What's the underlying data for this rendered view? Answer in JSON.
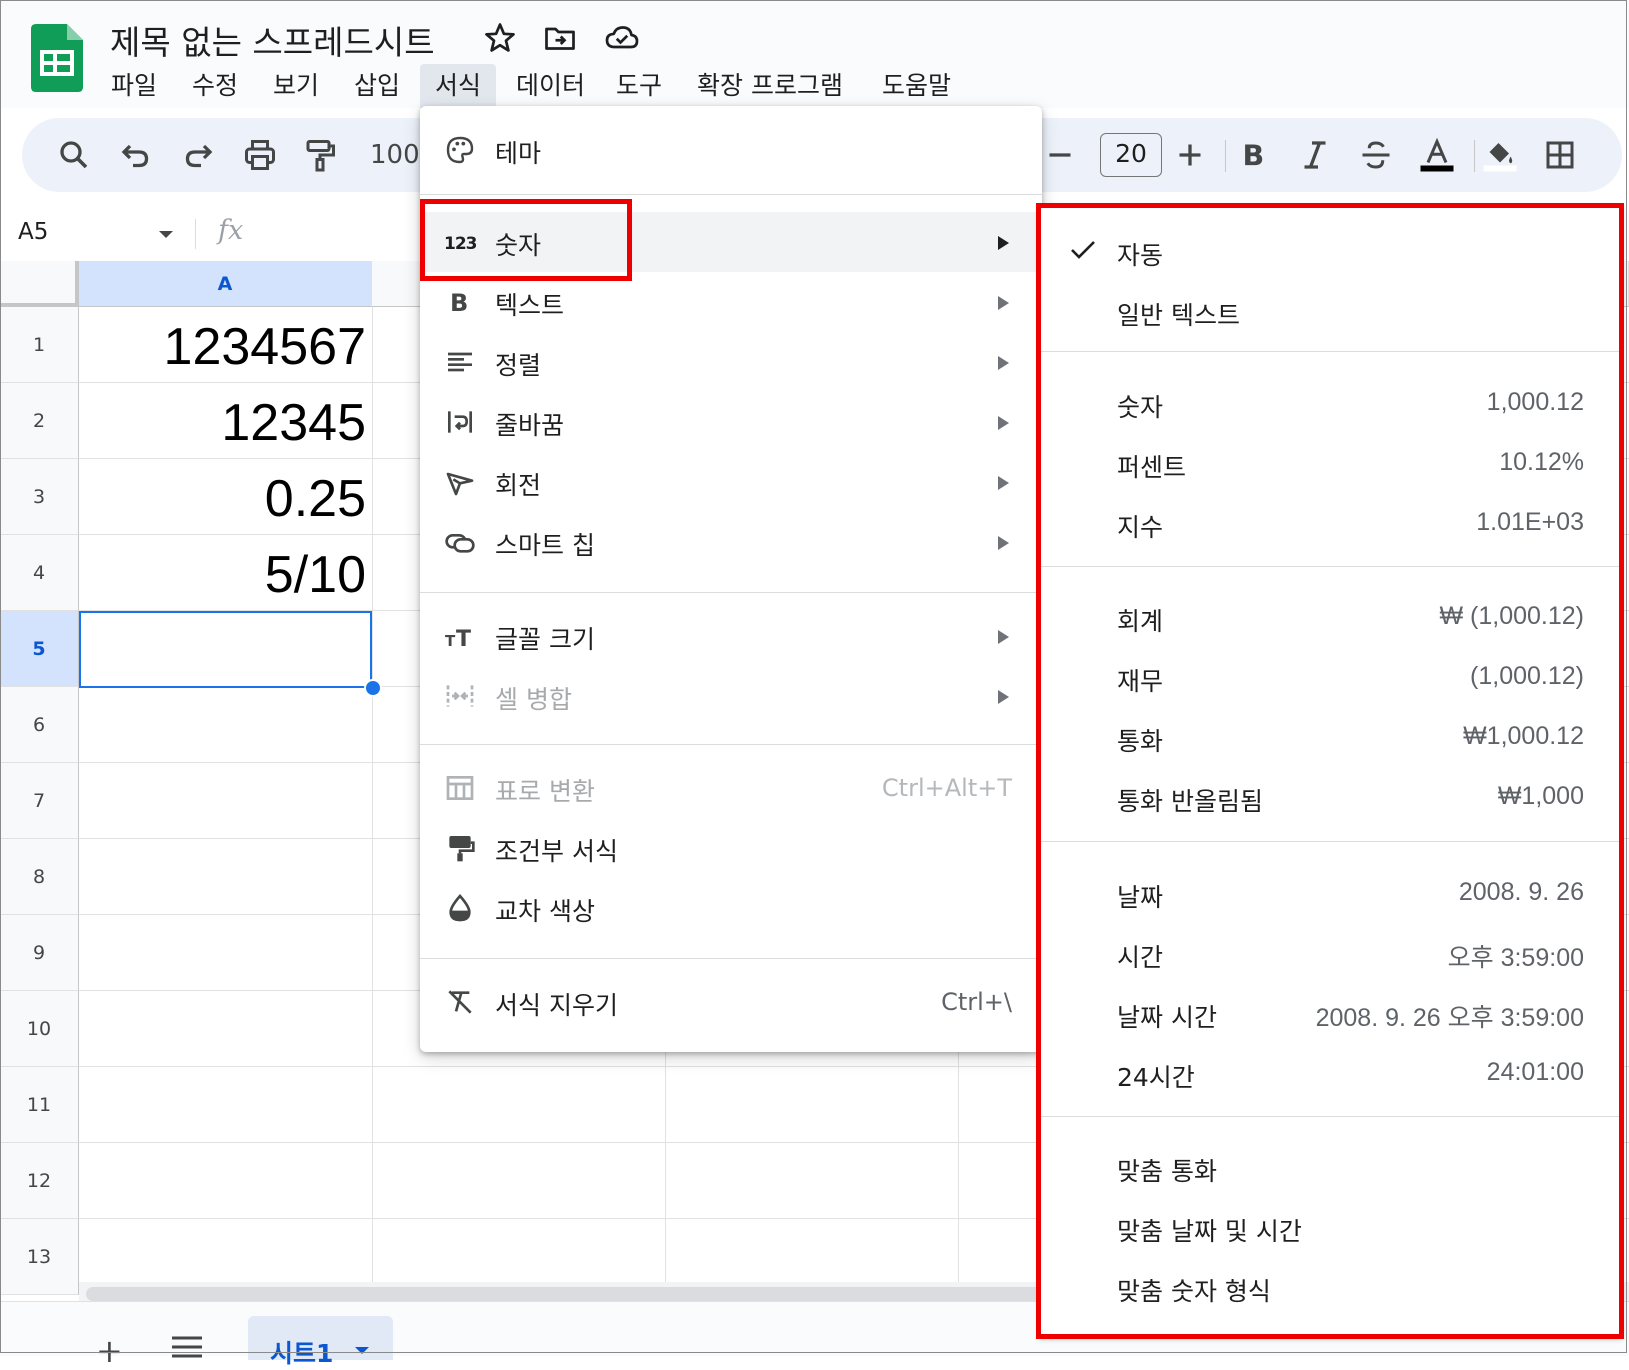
{
  "app": {
    "title": "제목 없는 스프레드시트",
    "menus": [
      "파일",
      "수정",
      "보기",
      "삽입",
      "서식",
      "데이터",
      "도구",
      "확장 프로그램",
      "도움말"
    ],
    "active_menu": "서식"
  },
  "toolbar": {
    "zoom": "100",
    "font_size": "20",
    "icons": [
      "search-icon",
      "undo-icon",
      "redo-icon",
      "print-icon",
      "paint-format-icon",
      "decrease-font-icon",
      "increase-font-icon",
      "bold-icon",
      "italic-icon",
      "strikethrough-icon",
      "text-color-icon",
      "fill-color-icon",
      "borders-icon"
    ]
  },
  "formula_bar": {
    "cell_ref": "A5",
    "fx": "fx"
  },
  "grid": {
    "column_headers": [
      "A"
    ],
    "row_numbers": [
      "1",
      "2",
      "3",
      "4",
      "5",
      "6",
      "7",
      "8",
      "9",
      "10",
      "11",
      "12",
      "13"
    ],
    "cells": [
      "1234567",
      "12345",
      "0.25",
      "5/10"
    ],
    "selected_cell": "A5"
  },
  "sheets": {
    "tabs": [
      "시트1"
    ]
  },
  "format_menu": {
    "items": [
      {
        "label": "테마",
        "icon": "palette-icon"
      },
      {
        "label": "숫자",
        "icon": "number-123-icon",
        "submenu": true,
        "highlighted": true
      },
      {
        "label": "텍스트",
        "icon": "bold-b-icon",
        "submenu": true
      },
      {
        "label": "정렬",
        "icon": "align-left-icon",
        "submenu": true
      },
      {
        "label": "줄바꿈",
        "icon": "text-wrap-icon",
        "submenu": true
      },
      {
        "label": "회전",
        "icon": "text-rotation-icon",
        "submenu": true
      },
      {
        "label": "스마트 칩",
        "icon": "smart-chip-icon",
        "submenu": true
      },
      {
        "label": "글꼴 크기",
        "icon": "font-size-icon",
        "submenu": true
      },
      {
        "label": "셀 병합",
        "icon": "merge-cells-icon",
        "submenu": true,
        "disabled": true
      },
      {
        "label": "표로 변환",
        "icon": "table-icon",
        "shortcut": "Ctrl+Alt+T",
        "disabled": true
      },
      {
        "label": "조건부 서식",
        "icon": "conditional-format-icon"
      },
      {
        "label": "교차 색상",
        "icon": "alternating-colors-icon"
      },
      {
        "label": "서식 지우기",
        "icon": "clear-format-icon",
        "shortcut": "Ctrl+\\"
      }
    ]
  },
  "number_submenu": {
    "items": [
      {
        "label": "자동",
        "checked": true
      },
      {
        "label": "일반 텍스트"
      },
      {
        "label": "숫자",
        "example": "1,000.12"
      },
      {
        "label": "퍼센트",
        "example": "10.12%"
      },
      {
        "label": "지수",
        "example": "1.01E+03"
      },
      {
        "label": "회계",
        "example": "₩ (1,000.12)"
      },
      {
        "label": "재무",
        "example": "(1,000.12)"
      },
      {
        "label": "통화",
        "example": "₩1,000.12"
      },
      {
        "label": "통화 반올림됨",
        "example": "₩1,000"
      },
      {
        "label": "날짜",
        "example": "2008. 9. 26"
      },
      {
        "label": "시간",
        "example": "오후 3:59:00"
      },
      {
        "label": "날짜 시간",
        "example": "2008. 9. 26 오후 3:59:00"
      },
      {
        "label": "24시간",
        "example": "24:01:00"
      },
      {
        "label": "맞춤 통화"
      },
      {
        "label": "맞춤 날짜 및 시간"
      },
      {
        "label": "맞춤 숫자 형식"
      }
    ]
  },
  "colors": {
    "highlight_box": "#ee0000",
    "selection": "#1a73e8",
    "sheets_green": "#0f9d58"
  }
}
